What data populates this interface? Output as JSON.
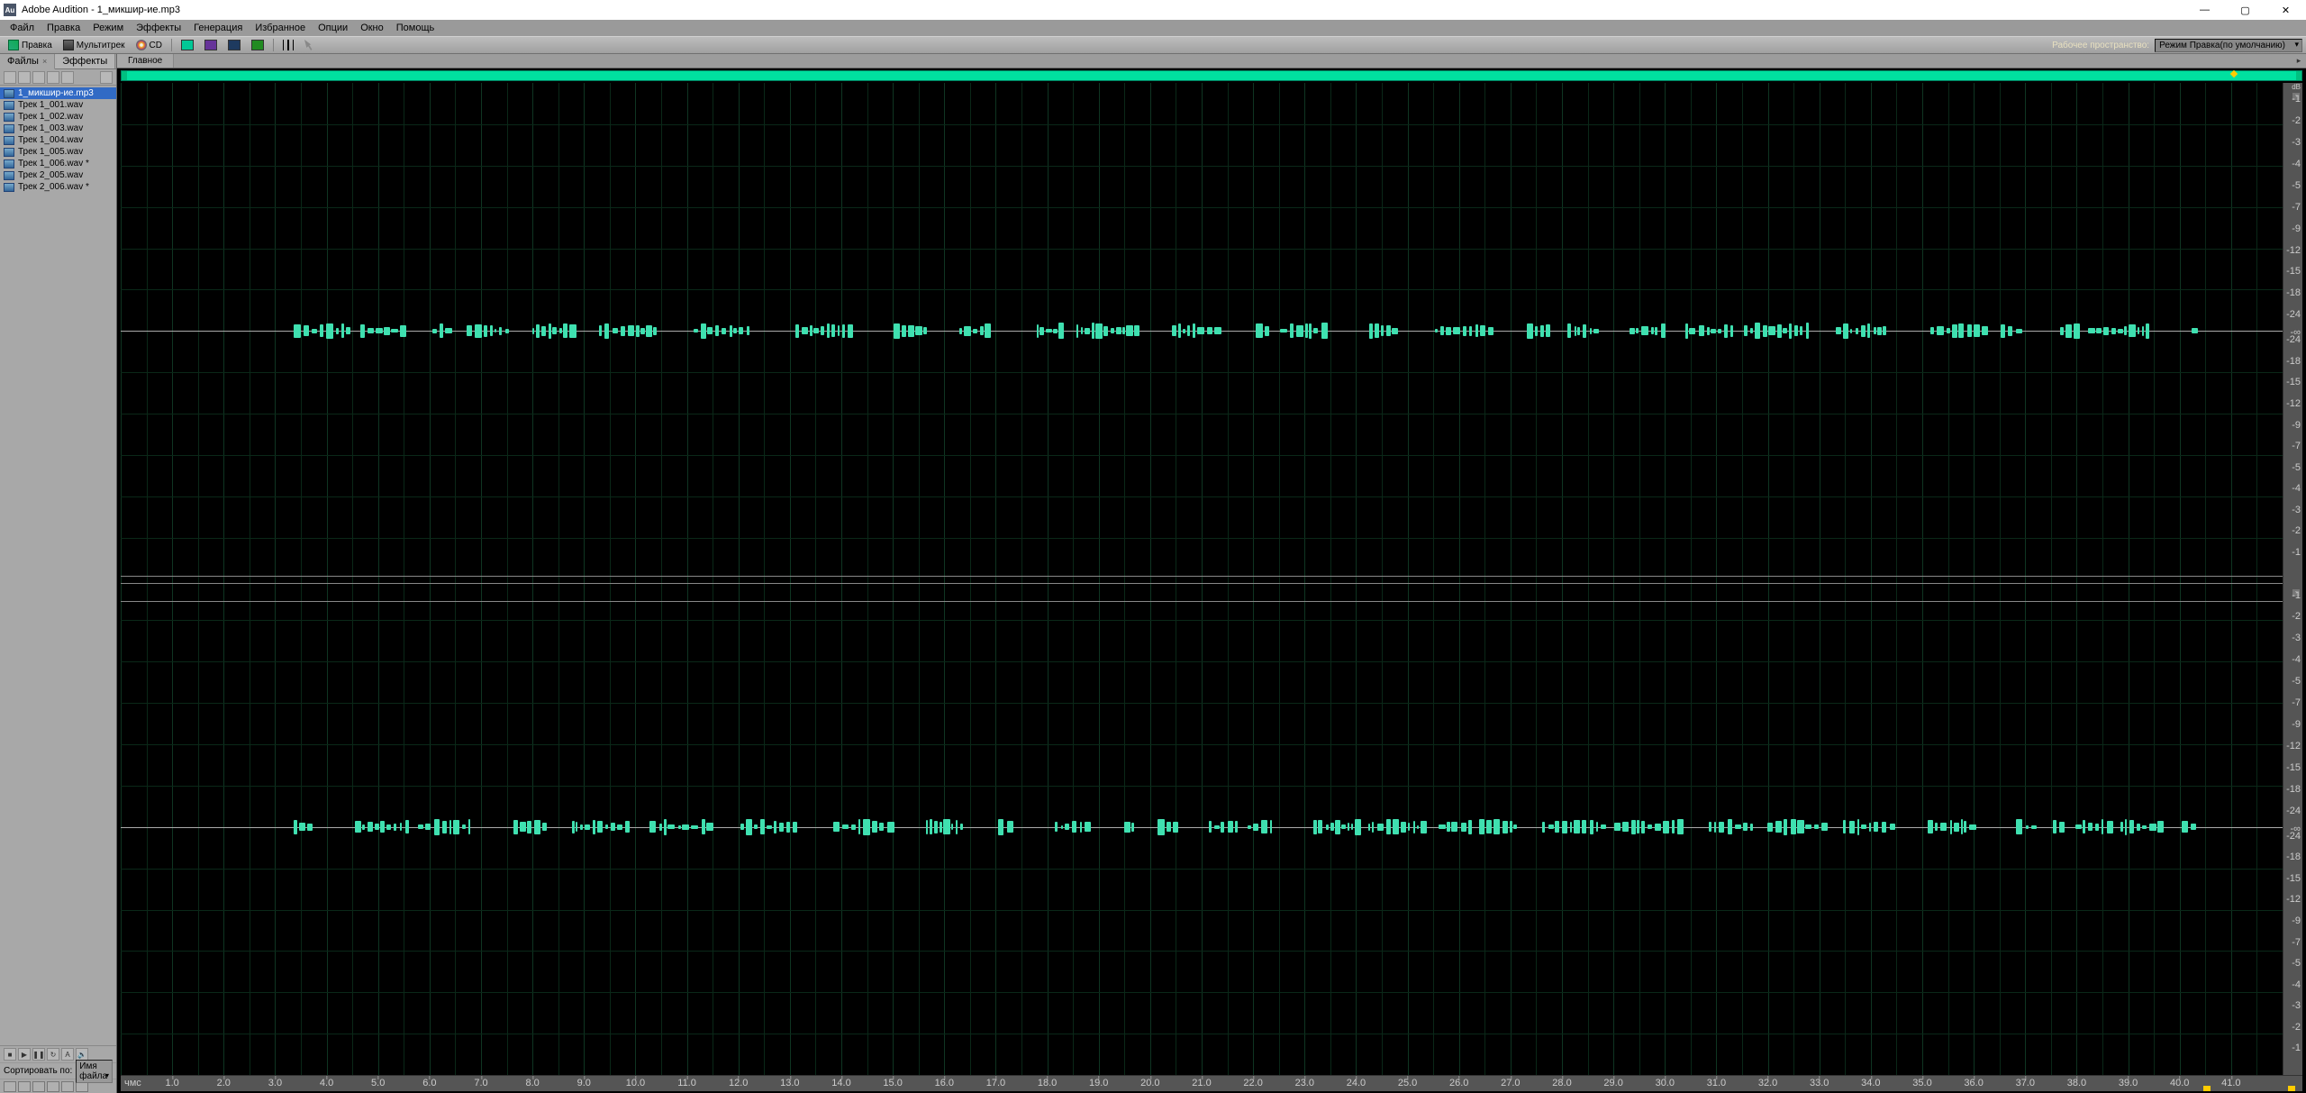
{
  "titlebar": {
    "app_icon_text": "Au",
    "title": "Adobe Audition - 1_микшир-ие.mp3"
  },
  "win_controls": {
    "min": "—",
    "max": "▢",
    "close": "✕"
  },
  "menubar": [
    "Файл",
    "Правка",
    "Режим",
    "Эффекты",
    "Генерация",
    "Избранное",
    "Опции",
    "Окно",
    "Помощь"
  ],
  "toolbar": {
    "edit": "Правка",
    "multitrack": "Мультитрек",
    "cd": "CD",
    "workspace_label": "Рабочее пространство:",
    "workspace_value": "Режим Правка(по умолчанию)"
  },
  "sidebar": {
    "tabs": [
      {
        "label": "Файлы",
        "closable": true
      },
      {
        "label": "Эффекты",
        "closable": false
      }
    ],
    "files": [
      {
        "name": "1_микшир-ие.mp3",
        "selected": true
      },
      {
        "name": "Трек 1_001.wav",
        "selected": false
      },
      {
        "name": "Трек 1_002.wav",
        "selected": false
      },
      {
        "name": "Трек 1_003.wav",
        "selected": false
      },
      {
        "name": "Трек 1_004.wav",
        "selected": false
      },
      {
        "name": "Трек 1_005.wav",
        "selected": false
      },
      {
        "name": "Трек 1_006.wav *",
        "selected": false
      },
      {
        "name": "Трек 2_005.wav",
        "selected": false
      },
      {
        "name": "Трек 2_006.wav *",
        "selected": false
      }
    ],
    "sort_label": "Сортировать по:",
    "sort_value": "Имя файла"
  },
  "editor": {
    "tab": "Главное",
    "db_header": "dB",
    "db_ticks": [
      "-1",
      "-2",
      "-3",
      "-4",
      "-5",
      "-7",
      "-9",
      "-12",
      "-15",
      "-18",
      "-24",
      "-∞",
      "-24",
      "-18",
      "-15",
      "-12",
      "-9",
      "-7",
      "-5",
      "-4",
      "-3",
      "-2",
      "-1"
    ],
    "time_label": "чмс",
    "time_ticks": [
      "1.0",
      "2.0",
      "3.0",
      "4.0",
      "5.0",
      "6.0",
      "7.0",
      "8.0",
      "9.0",
      "10.0",
      "11.0",
      "12.0",
      "13.0",
      "14.0",
      "15.0",
      "16.0",
      "17.0",
      "18.0",
      "19.0",
      "20.0",
      "21.0",
      "22.0",
      "23.0",
      "24.0",
      "25.0",
      "26.0",
      "27.0",
      "28.0",
      "29.0",
      "30.0",
      "31.0",
      "32.0",
      "33.0",
      "34.0",
      "35.0",
      "36.0",
      "37.0",
      "38.0",
      "39.0",
      "40.0",
      "41.0"
    ],
    "collapse": "-"
  }
}
